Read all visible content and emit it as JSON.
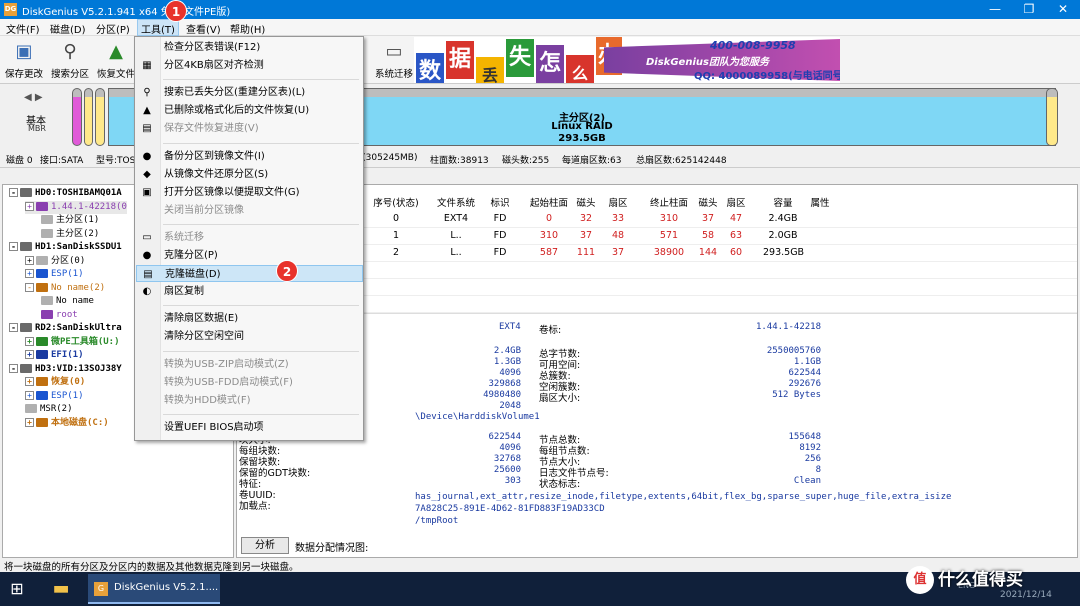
{
  "window": {
    "title": "DiskGenius V5.2.1.941 x64 免费",
    "title_suffix": "文件PE版)",
    "icon": "DG"
  },
  "menu": {
    "items": [
      {
        "id": "file",
        "label": "文件(F)"
      },
      {
        "id": "disk",
        "label": "磁盘(D)"
      },
      {
        "id": "partition",
        "label": "分区(P)"
      },
      {
        "id": "tools",
        "label": "工具(T)"
      },
      {
        "id": "view",
        "label": "查看(V)"
      },
      {
        "id": "help",
        "label": "帮助(H)"
      }
    ]
  },
  "toolbar": {
    "buttons": [
      {
        "label": "保存更改",
        "icon": "save-icon"
      },
      {
        "label": "搜索分区",
        "icon": "magnifier-icon"
      },
      {
        "label": "恢复文件",
        "icon": "recover-icon"
      },
      {
        "label": "系统迁移",
        "icon": "migrate-icon"
      }
    ]
  },
  "banner": {
    "chars": [
      "数",
      "据",
      "丢",
      "失",
      "怎",
      "么",
      "办"
    ],
    "slogan": "DiskGenius团队为您服务",
    "phone": "400-008-9958",
    "qq": "QQ: 4000089958(与电话同号)"
  },
  "diskbar": {
    "kind": "基本",
    "style": "MBR",
    "main_partition": {
      "name": "主分区(2)",
      "fs": "Linux RAID",
      "size": "293.5GB"
    }
  },
  "infobar": {
    "disk": "磁盘 0",
    "iface": "接口:SATA",
    "model": "型号:TOS",
    "capacity": "B(305245MB)",
    "cylinders": "柱面数:38913",
    "heads": "磁头数:255",
    "sectors": "每道扇区数:63",
    "total": "总扇区数:625142448"
  },
  "tree": [
    {
      "label": "HD0:TOSHIBAMQ01A",
      "level": 0,
      "exp": "-",
      "bold": true,
      "color": "#000"
    },
    {
      "label": "1.44.1-42218(0",
      "level": 1,
      "exp": "+",
      "bold": false,
      "color": "#8a3fb0",
      "selected": true
    },
    {
      "label": "主分区(1)",
      "level": 2,
      "exp": "",
      "bold": false,
      "color": "#000"
    },
    {
      "label": "主分区(2)",
      "level": 2,
      "exp": "",
      "bold": false,
      "color": "#000"
    },
    {
      "label": "HD1:SanDiskSSDU1",
      "level": 0,
      "exp": "-",
      "bold": true,
      "color": "#000"
    },
    {
      "label": "分区(0)",
      "level": 1,
      "exp": "+",
      "bold": false,
      "color": "#000"
    },
    {
      "label": "ESP(1)",
      "level": 1,
      "exp": "+",
      "bold": false,
      "color": "#1a55d0"
    },
    {
      "label": "No name(2)",
      "level": 1,
      "exp": "-",
      "bold": false,
      "color": "#c07010"
    },
    {
      "label": "No name",
      "level": 2,
      "exp": "",
      "bold": false,
      "color": "#000"
    },
    {
      "label": "root",
      "level": 2,
      "exp": "",
      "bold": false,
      "color": "#8a3fb0"
    },
    {
      "label": "RD2:SanDiskUltra",
      "level": 0,
      "exp": "-",
      "bold": true,
      "color": "#000"
    },
    {
      "label": "微PE工具箱(U:)",
      "level": 1,
      "exp": "+",
      "bold": true,
      "color": "#2a8a2a"
    },
    {
      "label": "EFI(1)",
      "level": 1,
      "exp": "+",
      "bold": true,
      "color": "#1a3aa0"
    },
    {
      "label": "HD3:VID:13SOJ38Y",
      "level": 0,
      "exp": "-",
      "bold": true,
      "color": "#000"
    },
    {
      "label": "恢复(0)",
      "level": 1,
      "exp": "+",
      "bold": true,
      "color": "#c07010"
    },
    {
      "label": "ESP(1)",
      "level": 1,
      "exp": "+",
      "bold": false,
      "color": "#1a55d0"
    },
    {
      "label": "MSR(2)",
      "level": 1,
      "exp": "",
      "bold": false,
      "color": "#000"
    },
    {
      "label": "本地磁盘(C:)",
      "level": 1,
      "exp": "+",
      "bold": true,
      "color": "#c07010"
    }
  ],
  "grid": {
    "headers": [
      "序号(状态)",
      "文件系统",
      "标识",
      "起始柱面",
      "磁头",
      "扇区",
      "终止柱面",
      "磁头",
      "扇区",
      "容量",
      "属性"
    ],
    "rows": [
      [
        "0",
        "EXT4",
        "FD",
        "0",
        "32",
        "33",
        "310",
        "37",
        "47",
        "2.4GB",
        ""
      ],
      [
        "1",
        "L..",
        "FD",
        "310",
        "37",
        "48",
        "571",
        "58",
        "63",
        "2.0GB",
        ""
      ],
      [
        "2",
        "L..",
        "FD",
        "587",
        "111",
        "37",
        "38900",
        "144",
        "60",
        "293.5GB",
        ""
      ]
    ]
  },
  "details": {
    "fs_type": "EXT4",
    "vol_label_key": "卷标:",
    "vol_label": "1.44.1-42218",
    "left_values": [
      "2.4GB",
      "1.3GB",
      "4096",
      "329868",
      "4980480",
      "2048"
    ],
    "right_labels": [
      "总字节数:",
      "可用空间:",
      "总簇数:",
      "空闲簇数:",
      "扇区大小:"
    ],
    "right_values": [
      "2550005760",
      "1.1GB",
      "622544",
      "292676",
      "512 Bytes"
    ],
    "device": "\\Device\\HarddiskVolume1",
    "ext_labels": [
      "块大小:",
      "每组块数:",
      "保留块数:",
      "保留的GDT块数:",
      "特征:",
      "卷UUID:",
      "加载点:"
    ],
    "ext_values": [
      "622544",
      "4096",
      "32768",
      "25600",
      "303"
    ],
    "ext_right_labels": [
      "节点总数:",
      "每组节点数:",
      "节点大小:",
      "日志文件节点号:",
      "状态标志:"
    ],
    "ext_right_values": [
      "155648",
      "8192",
      "256",
      "8",
      "Clean"
    ],
    "features": "has_journal,ext_attr,resize_inode,filetype,extents,64bit,flex_bg,sparse_super,huge_file,extra_isize",
    "uuid": "7A828C25-891E-4D62-81FD883F19AD33CD",
    "mount": "/tmpRoot",
    "analyze_button": "分析",
    "analysis_label": "数据分配情况图:"
  },
  "status": "将一块磁盘的所有分区及分区内的数据及其他数据克隆到另一块磁盘。",
  "dropdown": {
    "items": [
      {
        "label": "检查分区表错误(F12)",
        "icon": "",
        "disabled": false
      },
      {
        "label": "分区4KB扇区对齐检测",
        "icon": "▦",
        "disabled": false
      },
      {
        "sep": true
      },
      {
        "label": "搜索已丢失分区(重建分区表)(L)",
        "icon": "⚲",
        "disabled": false
      },
      {
        "label": "已删除或格式化后的文件恢复(U)",
        "icon": "▲",
        "disabled": false
      },
      {
        "label": "保存文件恢复进度(V)",
        "icon": "▤",
        "disabled": true
      },
      {
        "sep": true
      },
      {
        "label": "备份分区到镜像文件(I)",
        "icon": "●",
        "disabled": false
      },
      {
        "label": "从镜像文件还原分区(S)",
        "icon": "◆",
        "disabled": false
      },
      {
        "label": "打开分区镜像以便提取文件(G)",
        "icon": "▣",
        "disabled": false
      },
      {
        "label": "关闭当前分区镜像",
        "icon": "",
        "disabled": true
      },
      {
        "sep": true
      },
      {
        "label": "系统迁移",
        "icon": "▭",
        "disabled": true
      },
      {
        "label": "克隆分区(P)",
        "icon": "●",
        "disabled": false
      },
      {
        "label": "克隆磁盘(D)",
        "icon": "▤",
        "disabled": false,
        "highlight": true
      },
      {
        "label": "扇区复制",
        "icon": "◐",
        "disabled": false
      },
      {
        "sep": true
      },
      {
        "label": "清除扇区数据(E)",
        "icon": "",
        "disabled": false
      },
      {
        "label": "清除分区空闲空间",
        "icon": "",
        "disabled": false
      },
      {
        "sep": true
      },
      {
        "label": "转换为USB-ZIP启动模式(Z)",
        "icon": "",
        "disabled": true
      },
      {
        "label": "转换为USB-FDD启动模式(F)",
        "icon": "",
        "disabled": true
      },
      {
        "label": "转换为HDD模式(F)",
        "icon": "",
        "disabled": true
      },
      {
        "sep": true
      },
      {
        "label": "设置UEFI BIOS启动项",
        "icon": "",
        "disabled": false
      }
    ]
  },
  "callouts": [
    "1",
    "2"
  ],
  "taskbar": {
    "app_label": "DiskGenius V5.2.1....",
    "lang": "ENG",
    "date": "2021/12/14"
  },
  "watermark": {
    "logo": "值",
    "text": "什么值得买"
  }
}
